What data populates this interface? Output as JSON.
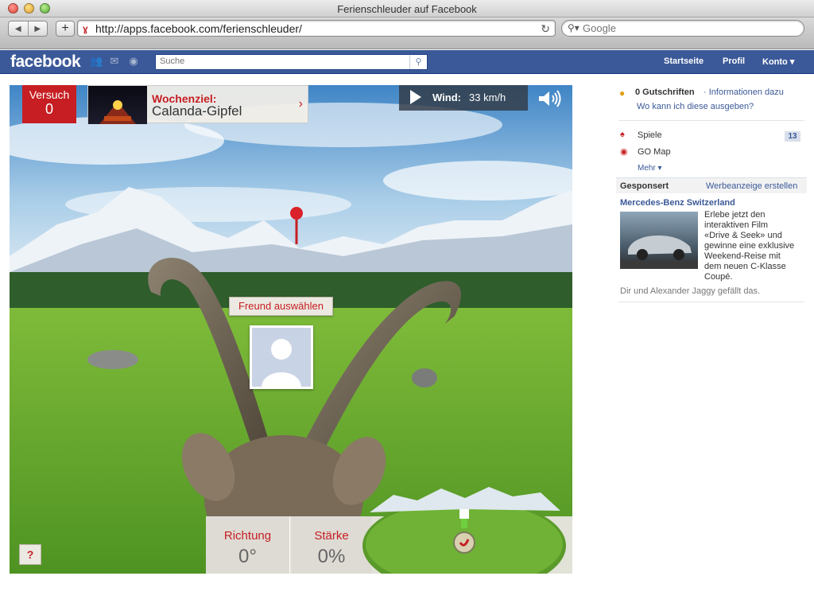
{
  "window": {
    "title": "Ferienschleuder auf Facebook"
  },
  "browser": {
    "url": "http://apps.facebook.com/ferienschleuder/",
    "search_placeholder": "Google"
  },
  "facebook": {
    "logo": "facebook",
    "search_placeholder": "Suche",
    "nav": {
      "home": "Startseite",
      "profile": "Profil",
      "account": "Konto ▾"
    }
  },
  "game": {
    "attempt_label": "Versuch",
    "attempt_value": "0",
    "weekly_goal_label": "Wochenziel:",
    "weekly_goal_value": "Calanda-Gipfel",
    "wind_label": "Wind:",
    "wind_value": "33 km/h",
    "friend_button": "Freund auswählen",
    "help_button": "?",
    "direction_label": "Richtung",
    "direction_value": "0°",
    "strength_label": "Stärke",
    "strength_value": "0%"
  },
  "sidebar": {
    "credits": "0 Gutschriften",
    "credits_info": "· Informationen dazu",
    "credits_where": "Wo kann ich diese ausgeben?",
    "apps": [
      {
        "label": "Spiele",
        "count": "13"
      },
      {
        "label": "GO Map"
      }
    ],
    "more": "Mehr ▾",
    "sponsored": "Gesponsert",
    "create_ad": "Werbeanzeige erstellen",
    "ad_title": "Mercedes-Benz Switzerland",
    "ad_text_lines": [
      "Erlebe jetzt den",
      "interaktiven Film",
      "«Drive & Seek» und",
      "gewinne eine exklusive",
      "Weekend-Reise mit",
      "dem neuen C-Klasse",
      "Coupé."
    ],
    "ad_social": "Dir und Alexander Jaggy gefällt das."
  }
}
